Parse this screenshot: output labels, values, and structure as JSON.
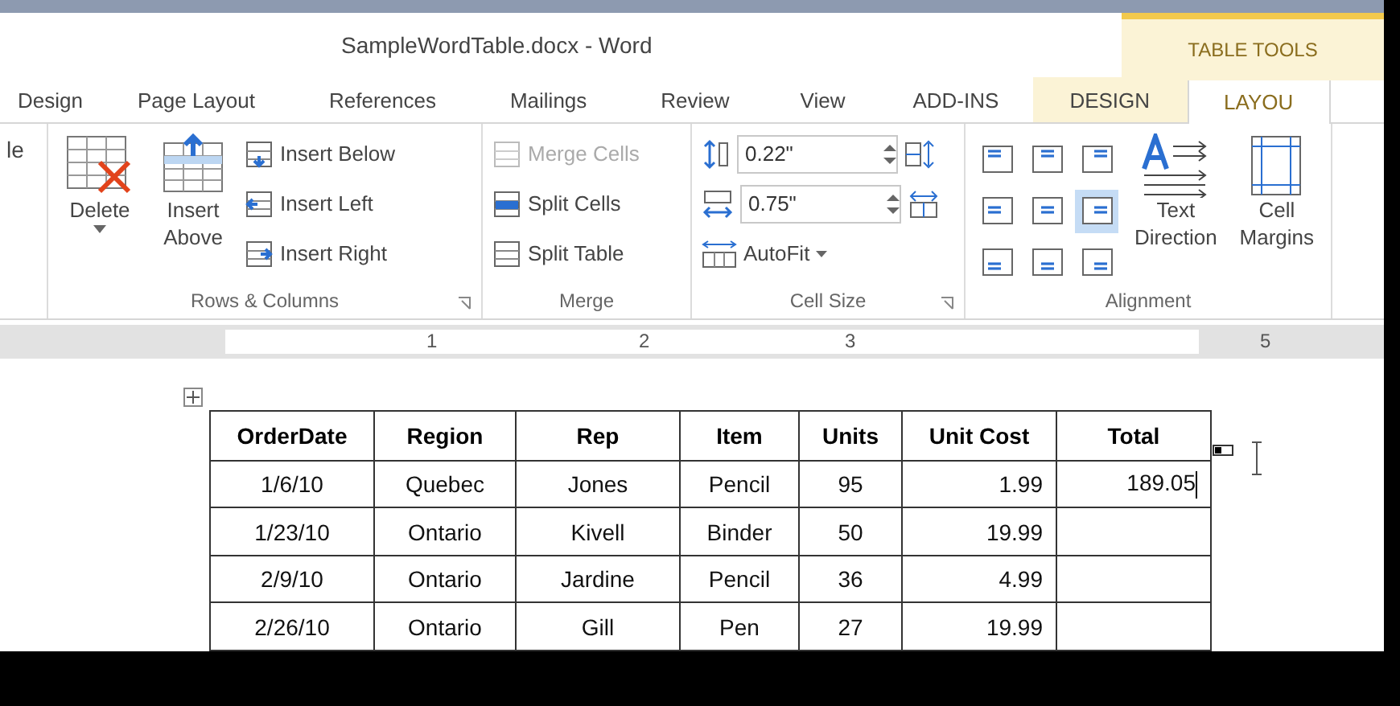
{
  "window": {
    "title": "SampleWordTable.docx - Word"
  },
  "contextual_group": "TABLE TOOLS",
  "tabs": [
    {
      "label": "Design",
      "selected": false,
      "contextual": false
    },
    {
      "label": "Page Layout",
      "selected": false,
      "contextual": false
    },
    {
      "label": "References",
      "selected": false,
      "contextual": false
    },
    {
      "label": "Mailings",
      "selected": false,
      "contextual": false
    },
    {
      "label": "Review",
      "selected": false,
      "contextual": false
    },
    {
      "label": "View",
      "selected": false,
      "contextual": false
    },
    {
      "label": "ADD-INS",
      "selected": false,
      "contextual": false
    },
    {
      "label": "DESIGN",
      "selected": false,
      "contextual": true
    },
    {
      "label": "LAYOU",
      "selected": true,
      "contextual": true
    }
  ],
  "ribbon": {
    "cut_left_label": "le",
    "rows_columns": {
      "label": "Rows & Columns",
      "delete": "Delete",
      "insert_above": [
        "Insert",
        "Above"
      ],
      "small": [
        {
          "label": "Insert Below",
          "kind": "below"
        },
        {
          "label": "Insert Left",
          "kind": "left"
        },
        {
          "label": "Insert Right",
          "kind": "right"
        }
      ]
    },
    "merge": {
      "label": "Merge",
      "items": [
        {
          "label": "Merge Cells",
          "kind": "merge",
          "disabled": true
        },
        {
          "label": "Split Cells",
          "kind": "splitcells",
          "disabled": false
        },
        {
          "label": "Split Table",
          "kind": "splittable",
          "disabled": false
        }
      ]
    },
    "cell_size": {
      "label": "Cell Size",
      "height": "0.22\"",
      "width": "0.75\"",
      "autofit": "AutoFit"
    },
    "alignment": {
      "label": "Alignment",
      "cells": [
        {
          "selected": false
        },
        {
          "selected": false
        },
        {
          "selected": false
        },
        {
          "selected": false
        },
        {
          "selected": false
        },
        {
          "selected": true
        },
        {
          "selected": false
        },
        {
          "selected": false
        },
        {
          "selected": false
        }
      ],
      "text_direction": [
        "Text",
        "Direction"
      ],
      "cell_margins": [
        "Cell",
        "Margins"
      ]
    }
  },
  "ruler": [
    "1",
    "2",
    "3",
    "5"
  ],
  "table": {
    "columns": [
      "OrderDate",
      "Region",
      "Rep",
      "Item",
      "Units",
      "Unit Cost",
      "Total"
    ],
    "rows": [
      {
        "cells": [
          "1/6/10",
          "Quebec",
          "Jones",
          "Pencil",
          "95",
          "1.99",
          "189.05"
        ],
        "editing": true
      },
      {
        "cells": [
          "1/23/10",
          "Ontario",
          "Kivell",
          "Binder",
          "50",
          "19.99",
          ""
        ],
        "editing": false
      },
      {
        "cells": [
          "2/9/10",
          "Ontario",
          "Jardine",
          "Pencil",
          "36",
          "4.99",
          ""
        ],
        "editing": false
      },
      {
        "cells": [
          "2/26/10",
          "Ontario",
          "Gill",
          "Pen",
          "27",
          "19.99",
          ""
        ],
        "editing": false
      }
    ]
  }
}
